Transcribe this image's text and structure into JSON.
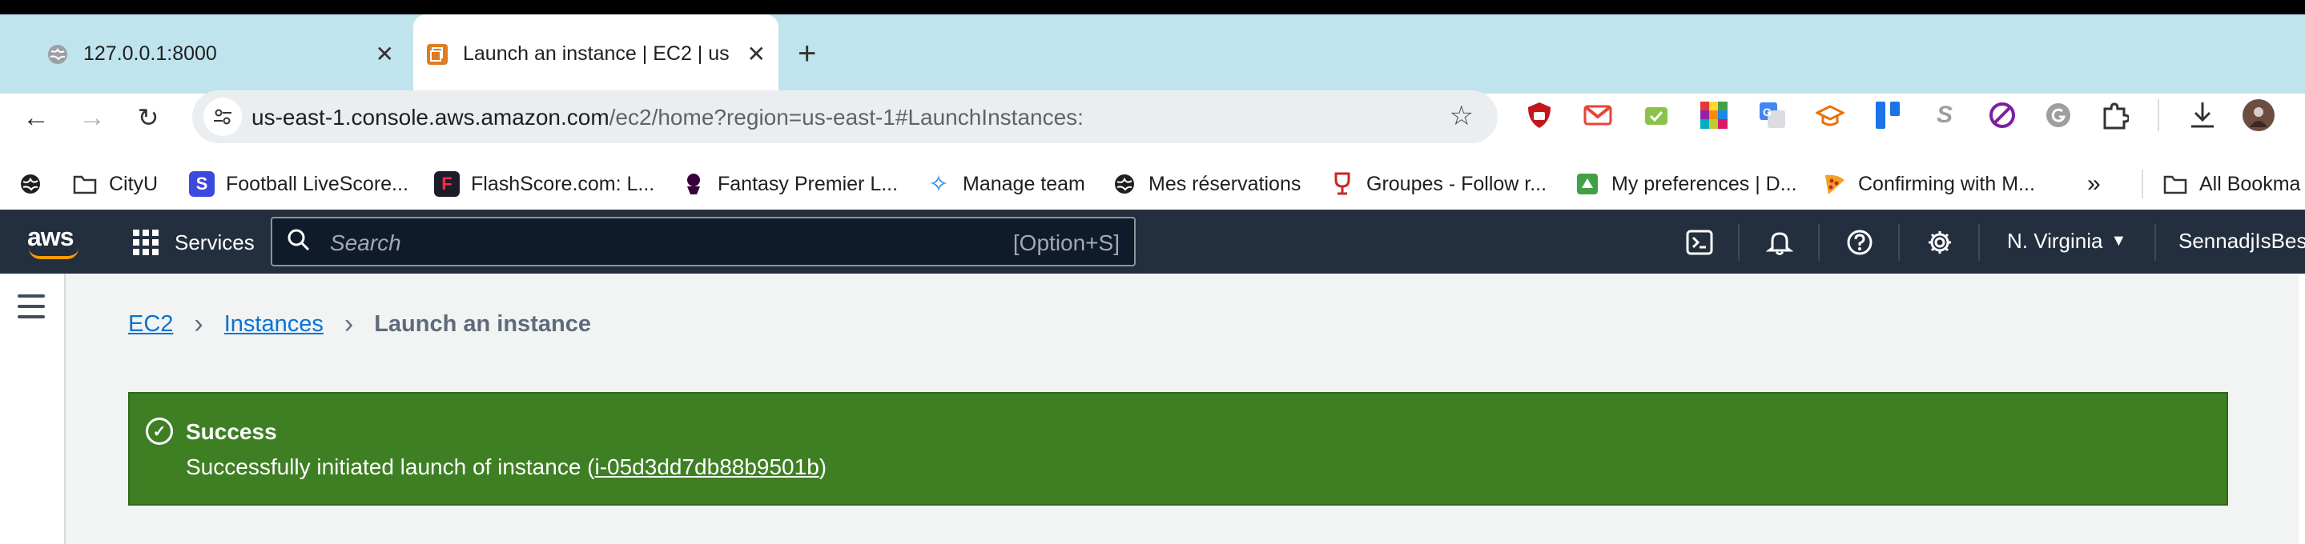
{
  "browser": {
    "tabs": [
      {
        "title": "127.0.0.1:8000",
        "icon": "globe-icon"
      },
      {
        "title": "Launch an instance | EC2 | us",
        "icon": "aws-ec2-icon",
        "active": true
      }
    ],
    "close_glyph": "✕",
    "new_tab_glyph": "+",
    "address": {
      "host": "us-east-1.console.aws.amazon.com",
      "path": "/ec2/home?region=us-east-1#LaunchInstances:"
    },
    "extensions": [
      "ublock-icon",
      "gmail-icon",
      "tasks-icon",
      "palette-icon",
      "translate-icon",
      "scholar-icon",
      "trello-icon",
      "s-icon",
      "block-icon",
      "grammarly-icon",
      "puzzle-icon",
      "download-icon",
      "profile-avatar"
    ]
  },
  "bookmarks": [
    {
      "label": "",
      "icon": "globe-icon"
    },
    {
      "label": "CityU",
      "icon": "folder-icon"
    },
    {
      "label": "Football LiveScore...",
      "icon": "livescore-icon"
    },
    {
      "label": "FlashScore.com: L...",
      "icon": "flashscore-icon"
    },
    {
      "label": "Fantasy Premier L...",
      "icon": "premier-league-icon"
    },
    {
      "label": "Manage team",
      "icon": "star-team-icon"
    },
    {
      "label": "Mes réservations",
      "icon": "globe-icon"
    },
    {
      "label": "Groupes - Follow r...",
      "icon": "trophy-icon"
    },
    {
      "label": "My preferences | D...",
      "icon": "preferences-icon"
    },
    {
      "label": "Confirming with M...",
      "icon": "pizza-icon"
    },
    {
      "label": "All Bookma",
      "icon": "folder-icon"
    }
  ],
  "bookmarks_overflow": "»",
  "aws": {
    "logo": "aws",
    "services_label": "Services",
    "search_placeholder": "Search",
    "search_shortcut": "[Option+S]",
    "region": "N. Virginia",
    "account": "SennadjIsBest"
  },
  "breadcrumb": {
    "items": [
      "EC2",
      "Instances"
    ],
    "current": "Launch an instance"
  },
  "flash": {
    "status": "success",
    "title": "Success",
    "message_prefix": "Successfully initiated launch of instance (",
    "instance_id": "i-05d3dd7db88b9501b",
    "message_suffix": ")",
    "color": "#3f7f24"
  }
}
